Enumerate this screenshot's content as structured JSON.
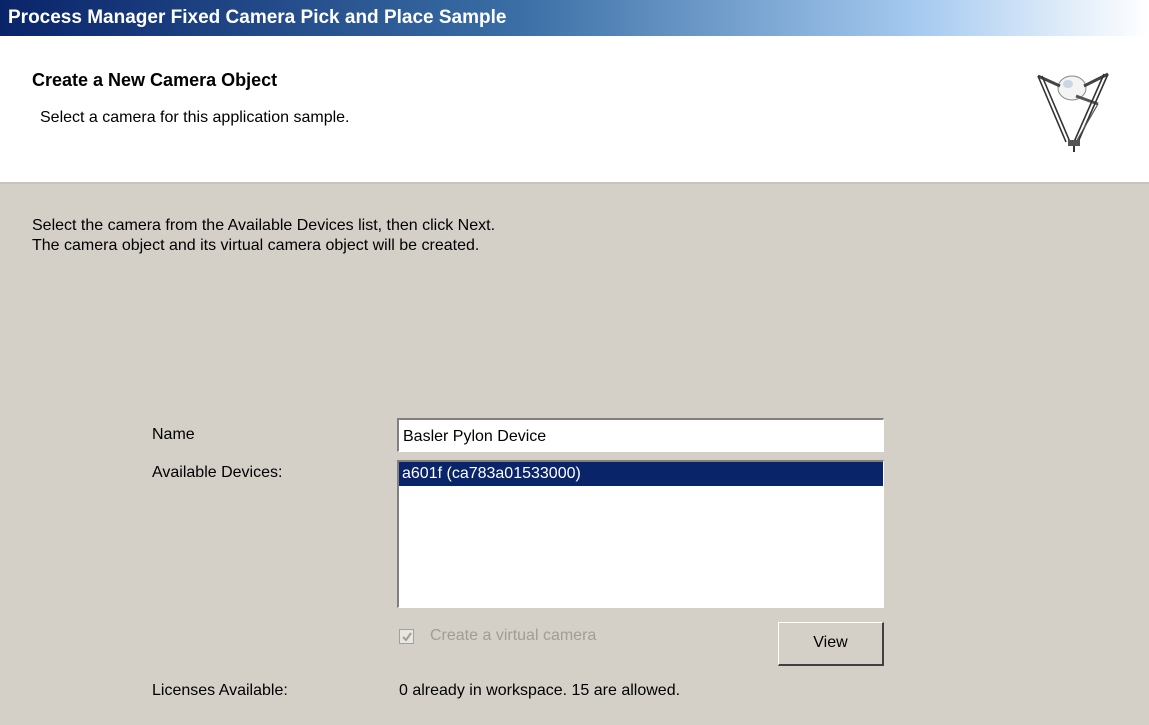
{
  "window": {
    "title": "Process Manager Fixed Camera Pick and Place Sample"
  },
  "header": {
    "title": "Create a New Camera Object",
    "subtitle": "Select a camera for this application sample.",
    "logo_icon": "delta-robot-icon"
  },
  "instructions": {
    "line1": "Select the camera from the Available Devices list, then click Next.",
    "line2": "The camera object and its virtual camera object will be created."
  },
  "form": {
    "name_label": "Name",
    "name_value": "Basler Pylon Device",
    "devices_label": "Available Devices:",
    "devices": [
      {
        "label": "a601f (ca783a01533000)",
        "selected": true
      }
    ],
    "virtual_camera_label": "Create a virtual camera",
    "virtual_camera_checked": true,
    "virtual_camera_enabled": false,
    "view_button_label": "View",
    "licenses_label": "Licenses Available:",
    "licenses_value": "0 already in workspace. 15 are allowed."
  },
  "colors": {
    "selection": "#0a246a",
    "dialog_background": "#d4d0c8",
    "disabled_text": "#a19d95"
  }
}
